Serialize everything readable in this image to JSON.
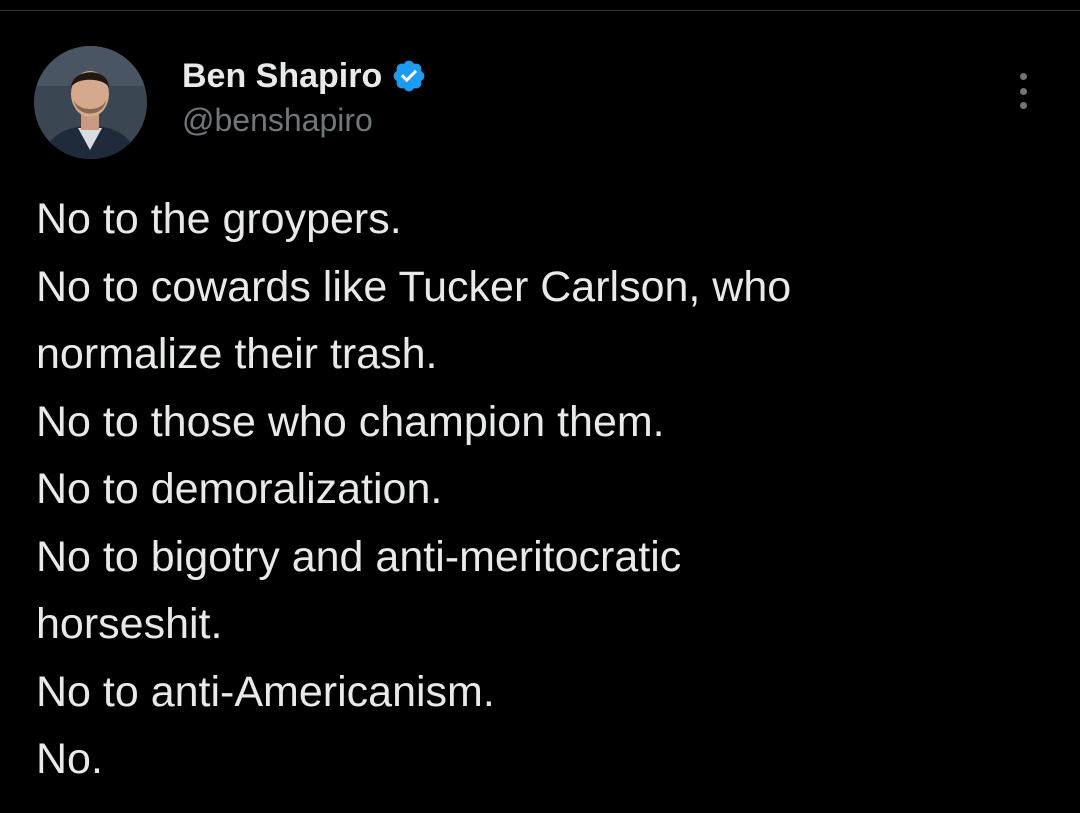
{
  "tweet": {
    "author": {
      "display_name": "Ben Shapiro",
      "handle": "@benshapiro",
      "verified": true,
      "verified_icon": "verified-badge-icon",
      "avatar_icon": "profile-photo"
    },
    "more_icon": "more-vertical-icon",
    "text_lines": [
      "No to the groypers.",
      "No to cowards like Tucker Carlson, who",
      "normalize their trash.",
      "No to those who champion them.",
      "No to demoralization.",
      "No to bigotry and anti-meritocratic",
      "horseshit.",
      "No to anti-Americanism.",
      "No."
    ]
  },
  "colors": {
    "background": "#000000",
    "text_primary": "#e7e9ea",
    "text_secondary": "#71767b",
    "verified_blue": "#1d9bf0",
    "divider": "#2f3336"
  }
}
